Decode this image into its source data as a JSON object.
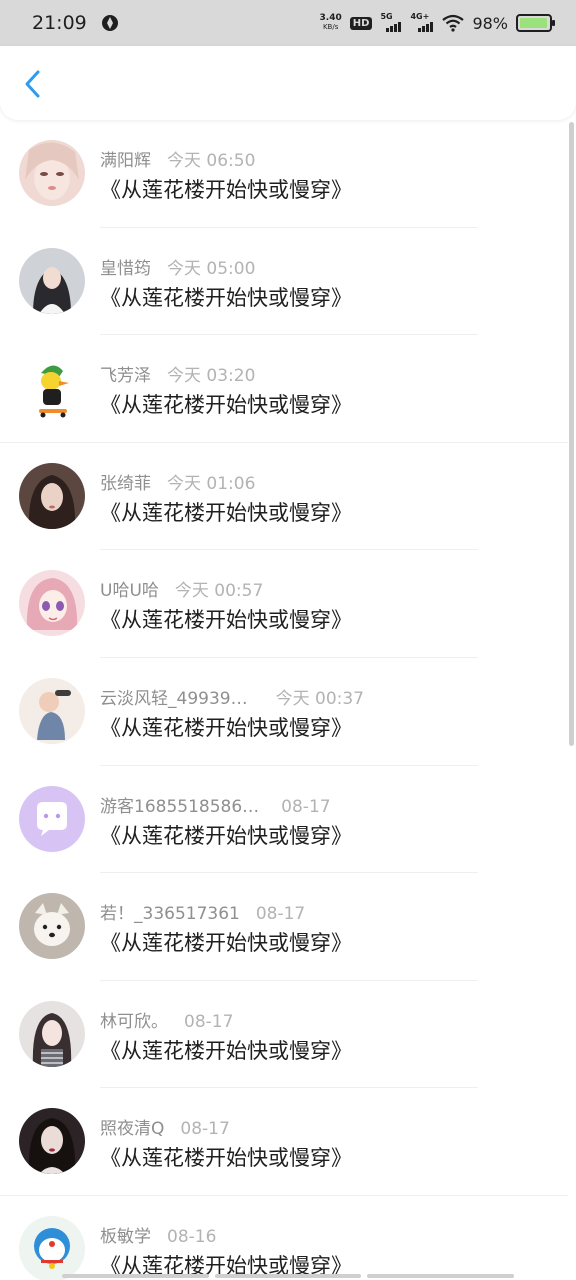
{
  "status_bar": {
    "time": "21:09",
    "net_speed": "3.40",
    "net_speed_unit": "KB/s",
    "hd_badge": "HD",
    "network_5g": "5G",
    "network_4g": "4G+",
    "battery_percent": "98%",
    "battery_level": 0.98,
    "battery_color": "#9ce27c"
  },
  "header": {
    "back_icon": "chevron-left-icon",
    "accent": "#2d9cf0"
  },
  "messages": [
    {
      "name": "满阳辉",
      "time": "今天 06:50",
      "text": "《从莲花楼开始快或慢穿》"
    },
    {
      "name": "皇惜筠",
      "time": "今天 05:00",
      "text": "《从莲花楼开始快或慢穿》"
    },
    {
      "name": "飞芳泽",
      "time": "今天 03:20",
      "text": "《从莲花楼开始快或慢穿》"
    },
    {
      "name": "张绮菲",
      "time": "今天 01:06",
      "text": "《从莲花楼开始快或慢穿》"
    },
    {
      "name": "U哈U哈",
      "time": "今天 00:57",
      "text": "《从莲花楼开始快或慢穿》"
    },
    {
      "name": "云淡风轻_49939…",
      "time": "今天 00:37",
      "text": "《从莲花楼开始快或慢穿》"
    },
    {
      "name": "游客1685518586…",
      "time": "08-17",
      "text": "《从莲花楼开始快或慢穿》"
    },
    {
      "name": "若！_336517361",
      "time": "08-17",
      "text": "《从莲花楼开始快或慢穿》"
    },
    {
      "name": "林可欣。",
      "time": "08-17",
      "text": "《从莲花楼开始快或慢穿》"
    },
    {
      "name": "照夜清Q",
      "time": "08-17",
      "text": "《从莲花楼开始快或慢穿》"
    },
    {
      "name": "板敏学",
      "time": "08-16",
      "text": "《从莲花楼开始快或慢穿》"
    }
  ]
}
